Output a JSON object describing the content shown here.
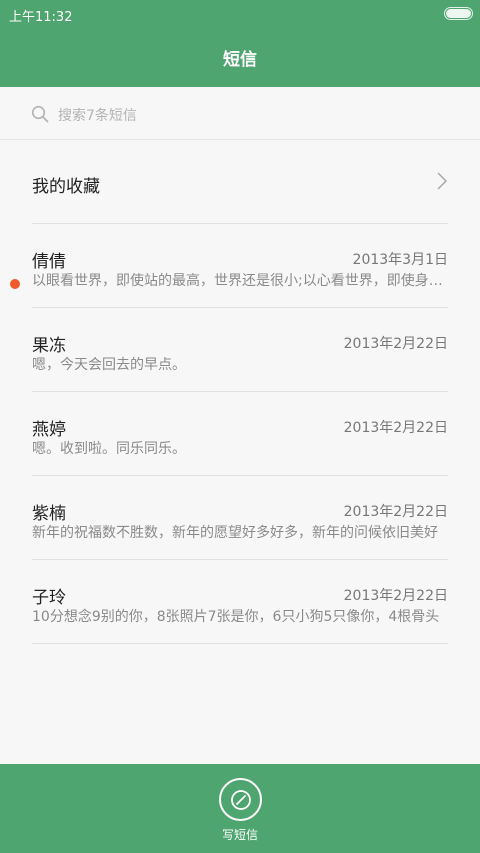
{
  "status_bar": {
    "time": "上午11:32",
    "battery_level": 1.0
  },
  "header": {
    "title": "短信"
  },
  "search": {
    "placeholder": "搜索7条短信",
    "icon": "search-icon"
  },
  "favorites": {
    "label": "我的收藏",
    "icon": "chevron-right-icon"
  },
  "conversations": [
    {
      "name": "倩倩",
      "date": "2013年3月1日",
      "preview": "以眼看世界，即使站的最高，世界还是很小;以心看世界，即使身处最低处，世界也是很大",
      "unread": false
    },
    {
      "name": "果冻",
      "date": "2013年2月22日",
      "preview": "嗯，今天会回去的早点。",
      "unread": false
    },
    {
      "name": "燕婷",
      "date": "2013年2月22日",
      "preview": "嗯。收到啦。同乐同乐。",
      "unread": true
    },
    {
      "name": "紫楠",
      "date": "2013年2月22日",
      "preview": "新年的祝福数不胜数，新年的愿望好多好多，新年的问候依旧美好",
      "unread": false
    },
    {
      "name": "子玲",
      "date": "2013年2月22日",
      "preview": "10分想念9别的你，8张照片7张是你，6只小狗5只像你，4根骨头",
      "unread": false
    }
  ],
  "bottom_bar": {
    "compose_label": "写短信",
    "icon": "compose-icon"
  },
  "colors": {
    "accent": "#4ea56f",
    "unread": "#f0592a"
  }
}
